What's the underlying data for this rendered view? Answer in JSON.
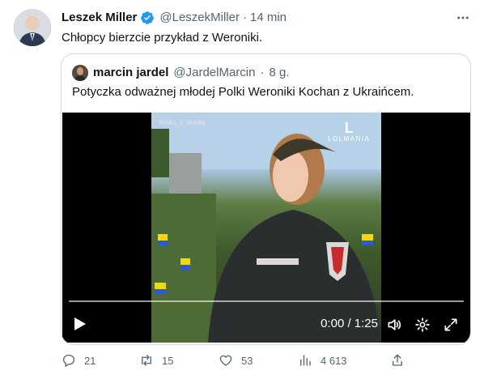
{
  "tweet": {
    "author_name": "Leszek Miller",
    "author_handle": "@LeszekMiller",
    "separator": "·",
    "time": "14 min",
    "text": "Chłopcy bierzcie przykład z Weroniki."
  },
  "quote": {
    "author_name": "marcin jardel",
    "author_handle": "@JardelMarcin",
    "separator": "·",
    "time": "8 g.",
    "text": "Potyczka odważnej młodej Polki Weroniki Kochan z Ukraińcem.",
    "video": {
      "watermark": "feniks_z_tiktoka",
      "brand_mark": "L",
      "brand_name": "LOLMANIA",
      "time_display": "0:00 / 1:25"
    }
  },
  "actions": {
    "replies": "21",
    "retweets": "15",
    "likes": "53",
    "views": "4 613"
  },
  "colors": {
    "verified": "#1d9bf0",
    "text": "#0f1419",
    "secondary": "#536471",
    "border": "#cfd9de"
  }
}
